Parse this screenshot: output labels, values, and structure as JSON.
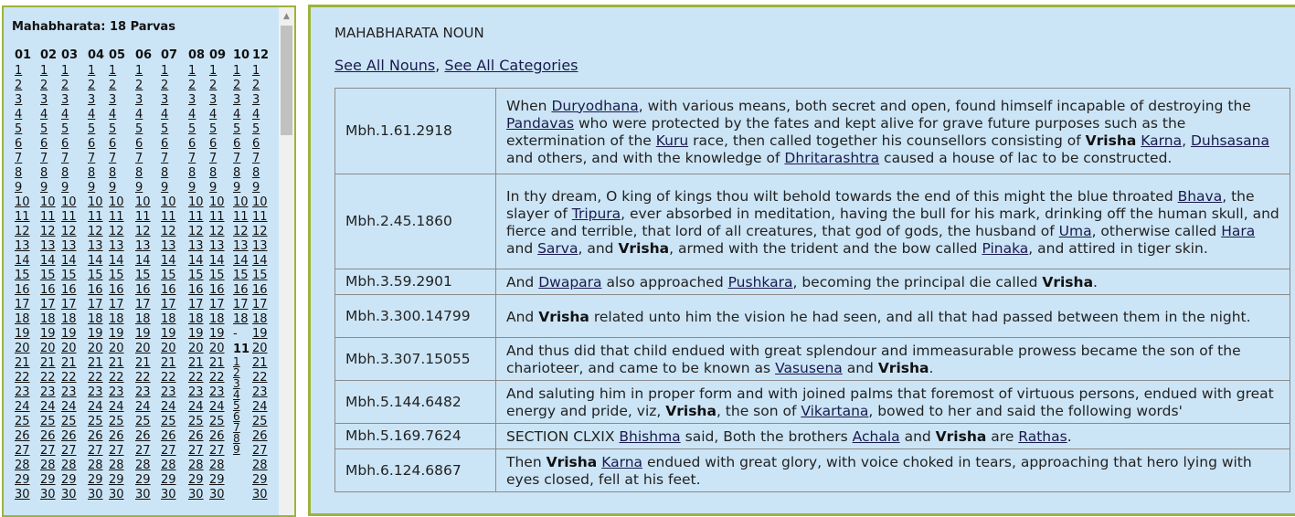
{
  "sidebar": {
    "title": "Mahabharata: 18 Parvas",
    "columns": [
      "01",
      "02",
      "03",
      "04",
      "05",
      "06",
      "07",
      "08",
      "09",
      "10",
      "12"
    ],
    "numbers": [
      "1",
      "2",
      "3",
      "4",
      "5",
      "6",
      "7",
      "8",
      "9",
      "10",
      "11",
      "12",
      "13",
      "14",
      "15",
      "16",
      "17",
      "18",
      "19",
      "20",
      "21",
      "22",
      "23",
      "24",
      "25",
      "26",
      "27",
      "28",
      "29",
      "30"
    ],
    "column_10": {
      "numbers": [
        "1",
        "2",
        "3",
        "4",
        "5",
        "6",
        "7",
        "8",
        "9",
        "10",
        "11",
        "12",
        "13",
        "14",
        "15",
        "16",
        "17",
        "18"
      ],
      "dash": "-",
      "sub_heading": "11",
      "sub_numbers": [
        "1",
        "2",
        "3",
        "4",
        "5",
        "6",
        "7",
        "8",
        "9"
      ]
    }
  },
  "main": {
    "title": "MAHABHARATA NOUN",
    "link_all_nouns": "See All Nouns",
    "separator": ", ",
    "link_all_categories": "See All Categories",
    "rows": [
      {
        "ref": "Mbh.1.61.2918",
        "parts": [
          {
            "t": "When "
          },
          {
            "l": "Duryodhana"
          },
          {
            "t": ", with various means, both secret and open, found himself incapable of destroying the "
          },
          {
            "l": "Pandavas"
          },
          {
            "t": " who were protected by the fates and kept alive for grave future purposes such as the extermination of the "
          },
          {
            "l": "Kuru"
          },
          {
            "t": " race, then called together his counsellors consisting of "
          },
          {
            "b": "Vrisha"
          },
          {
            "t": " "
          },
          {
            "l": "Karna"
          },
          {
            "t": ", "
          },
          {
            "l": "Duhsasana"
          },
          {
            "t": " and others, and with the knowledge of "
          },
          {
            "l": "Dhritarashtra"
          },
          {
            "t": " caused a house of lac to be constructed."
          }
        ]
      },
      {
        "ref": "Mbh.2.45.1860",
        "parts": [
          {
            "t": "In thy dream, O king of kings thou wilt behold towards the end of this might the blue throated "
          },
          {
            "l": "Bhava"
          },
          {
            "t": ", the slayer of "
          },
          {
            "l": "Tripura"
          },
          {
            "t": ", ever absorbed in meditation, having the bull for his mark, drinking off the human skull, and fierce and terrible, that lord of all creatures, that god of gods, the husband of "
          },
          {
            "l": "Uma"
          },
          {
            "t": ", otherwise called "
          },
          {
            "l": "Hara"
          },
          {
            "t": " and "
          },
          {
            "l": "Sarva"
          },
          {
            "t": ", and "
          },
          {
            "b": "Vrisha"
          },
          {
            "t": ", armed with the trident and the bow called "
          },
          {
            "l": "Pinaka"
          },
          {
            "t": ", and attired in tiger skin."
          }
        ]
      },
      {
        "ref": "Mbh.3.59.2901",
        "parts": [
          {
            "t": "And "
          },
          {
            "l": "Dwapara"
          },
          {
            "t": " also approached "
          },
          {
            "l": "Pushkara"
          },
          {
            "t": ", becoming the principal die called "
          },
          {
            "b": "Vrisha"
          },
          {
            "t": "."
          }
        ]
      },
      {
        "ref": "Mbh.3.300.14799",
        "parts": [
          {
            "t": "And "
          },
          {
            "b": "Vrisha"
          },
          {
            "t": " related unto him the vision he had seen, and all that had passed between them in the night."
          }
        ]
      },
      {
        "ref": "Mbh.3.307.15055",
        "parts": [
          {
            "t": "And thus did that child endued with great splendour and immeasurable prowess became the son of the charioteer, and came to be known as "
          },
          {
            "l": "Vasusena"
          },
          {
            "t": " and "
          },
          {
            "b": "Vrisha"
          },
          {
            "t": "."
          }
        ]
      },
      {
        "ref": "Mbh.5.144.6482",
        "parts": [
          {
            "t": "And saluting him in proper form and with joined palms that foremost of virtuous persons, endued with great energy and pride, viz, "
          },
          {
            "b": "Vrisha"
          },
          {
            "t": ", the son of "
          },
          {
            "l": "Vikartana"
          },
          {
            "t": ", bowed to her and said the following words'"
          }
        ]
      },
      {
        "ref": "Mbh.5.169.7624",
        "parts": [
          {
            "t": "SECTION CLXIX "
          },
          {
            "l": "Bhishma"
          },
          {
            "t": " said, Both the brothers "
          },
          {
            "l": "Achala"
          },
          {
            "t": " and "
          },
          {
            "b": "Vrisha"
          },
          {
            "t": " are "
          },
          {
            "l": "Rathas"
          },
          {
            "t": "."
          }
        ]
      },
      {
        "ref": "Mbh.6.124.6867",
        "parts": [
          {
            "t": "Then "
          },
          {
            "b": "Vrisha"
          },
          {
            "t": " "
          },
          {
            "l": "Karna"
          },
          {
            "t": " endued with great glory, with voice choked in tears, approaching that hero lying with eyes closed, fell at his feet."
          }
        ]
      }
    ]
  }
}
